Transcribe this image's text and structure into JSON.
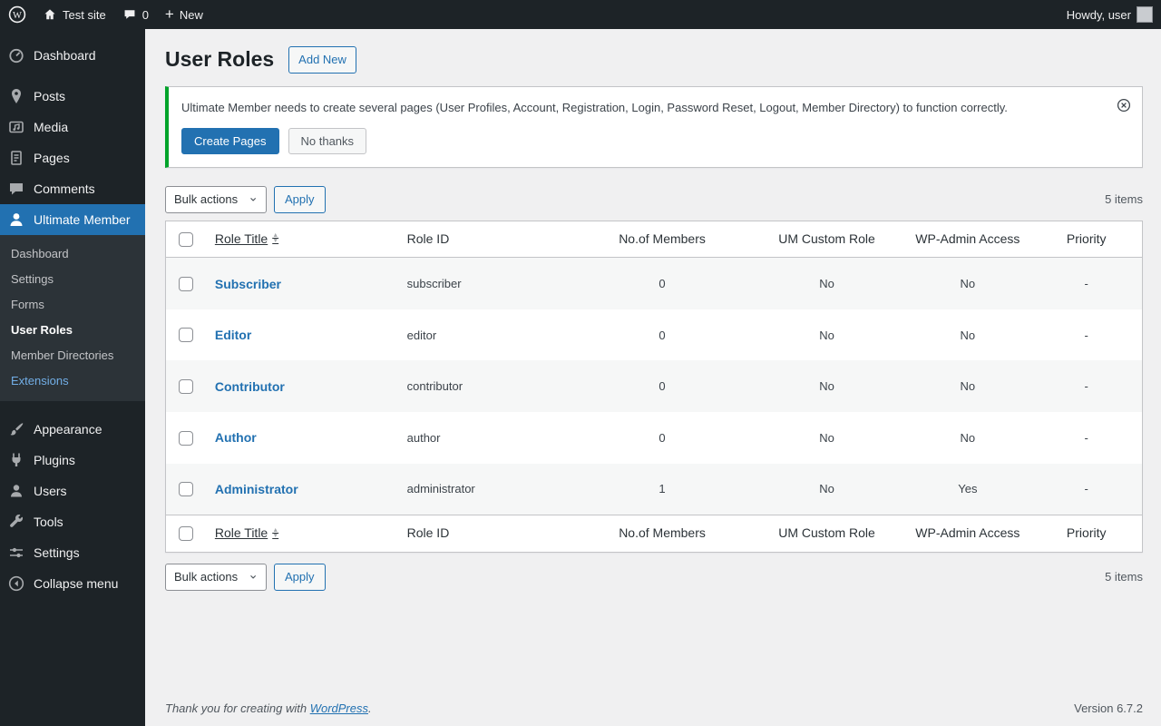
{
  "colors": {
    "accent": "#2271b1",
    "notice_border": "#00a32a",
    "admin_bar_bg": "#1d2327",
    "submenu_bg": "#2c3338",
    "extensions_link": "#72aee6"
  },
  "admin_bar": {
    "site_name": "Test site",
    "comments_count": "0",
    "new_label": "New",
    "howdy": "Howdy, user"
  },
  "sidebar": {
    "items": [
      {
        "label": "Dashboard"
      },
      {
        "label": "Posts"
      },
      {
        "label": "Media"
      },
      {
        "label": "Pages"
      },
      {
        "label": "Comments"
      },
      {
        "label": "Ultimate Member"
      },
      {
        "label": "Appearance"
      },
      {
        "label": "Plugins"
      },
      {
        "label": "Users"
      },
      {
        "label": "Tools"
      },
      {
        "label": "Settings"
      },
      {
        "label": "Collapse menu"
      }
    ],
    "submenu": [
      {
        "label": "Dashboard"
      },
      {
        "label": "Settings"
      },
      {
        "label": "Forms"
      },
      {
        "label": "User Roles"
      },
      {
        "label": "Member Directories"
      },
      {
        "label": "Extensions"
      }
    ]
  },
  "page": {
    "title": "User Roles",
    "add_new": "Add New"
  },
  "notice": {
    "text": "Ultimate Member needs to create several pages (User Profiles, Account, Registration, Login, Password Reset, Logout, Member Directory) to function correctly.",
    "create_pages": "Create Pages",
    "no_thanks": "No thanks"
  },
  "toolbar": {
    "bulk_actions": "Bulk actions",
    "apply": "Apply",
    "items_count": "5 items"
  },
  "table": {
    "headers": {
      "role_title": "Role Title",
      "role_id": "Role ID",
      "members": "No.of Members",
      "custom_role": "UM Custom Role",
      "admin_access": "WP-Admin Access",
      "priority": "Priority"
    },
    "rows": [
      {
        "title": "Subscriber",
        "role_id": "subscriber",
        "members": "0",
        "custom_role": "No",
        "admin_access": "No",
        "priority": "-"
      },
      {
        "title": "Editor",
        "role_id": "editor",
        "members": "0",
        "custom_role": "No",
        "admin_access": "No",
        "priority": "-"
      },
      {
        "title": "Contributor",
        "role_id": "contributor",
        "members": "0",
        "custom_role": "No",
        "admin_access": "No",
        "priority": "-"
      },
      {
        "title": "Author",
        "role_id": "author",
        "members": "0",
        "custom_role": "No",
        "admin_access": "No",
        "priority": "-"
      },
      {
        "title": "Administrator",
        "role_id": "administrator",
        "members": "1",
        "custom_role": "No",
        "admin_access": "Yes",
        "priority": "-"
      }
    ]
  },
  "footer": {
    "thank_you": "Thank you for creating with",
    "wordpress_link": "WordPress",
    "suffix": ".",
    "version": "Version 6.7.2"
  }
}
